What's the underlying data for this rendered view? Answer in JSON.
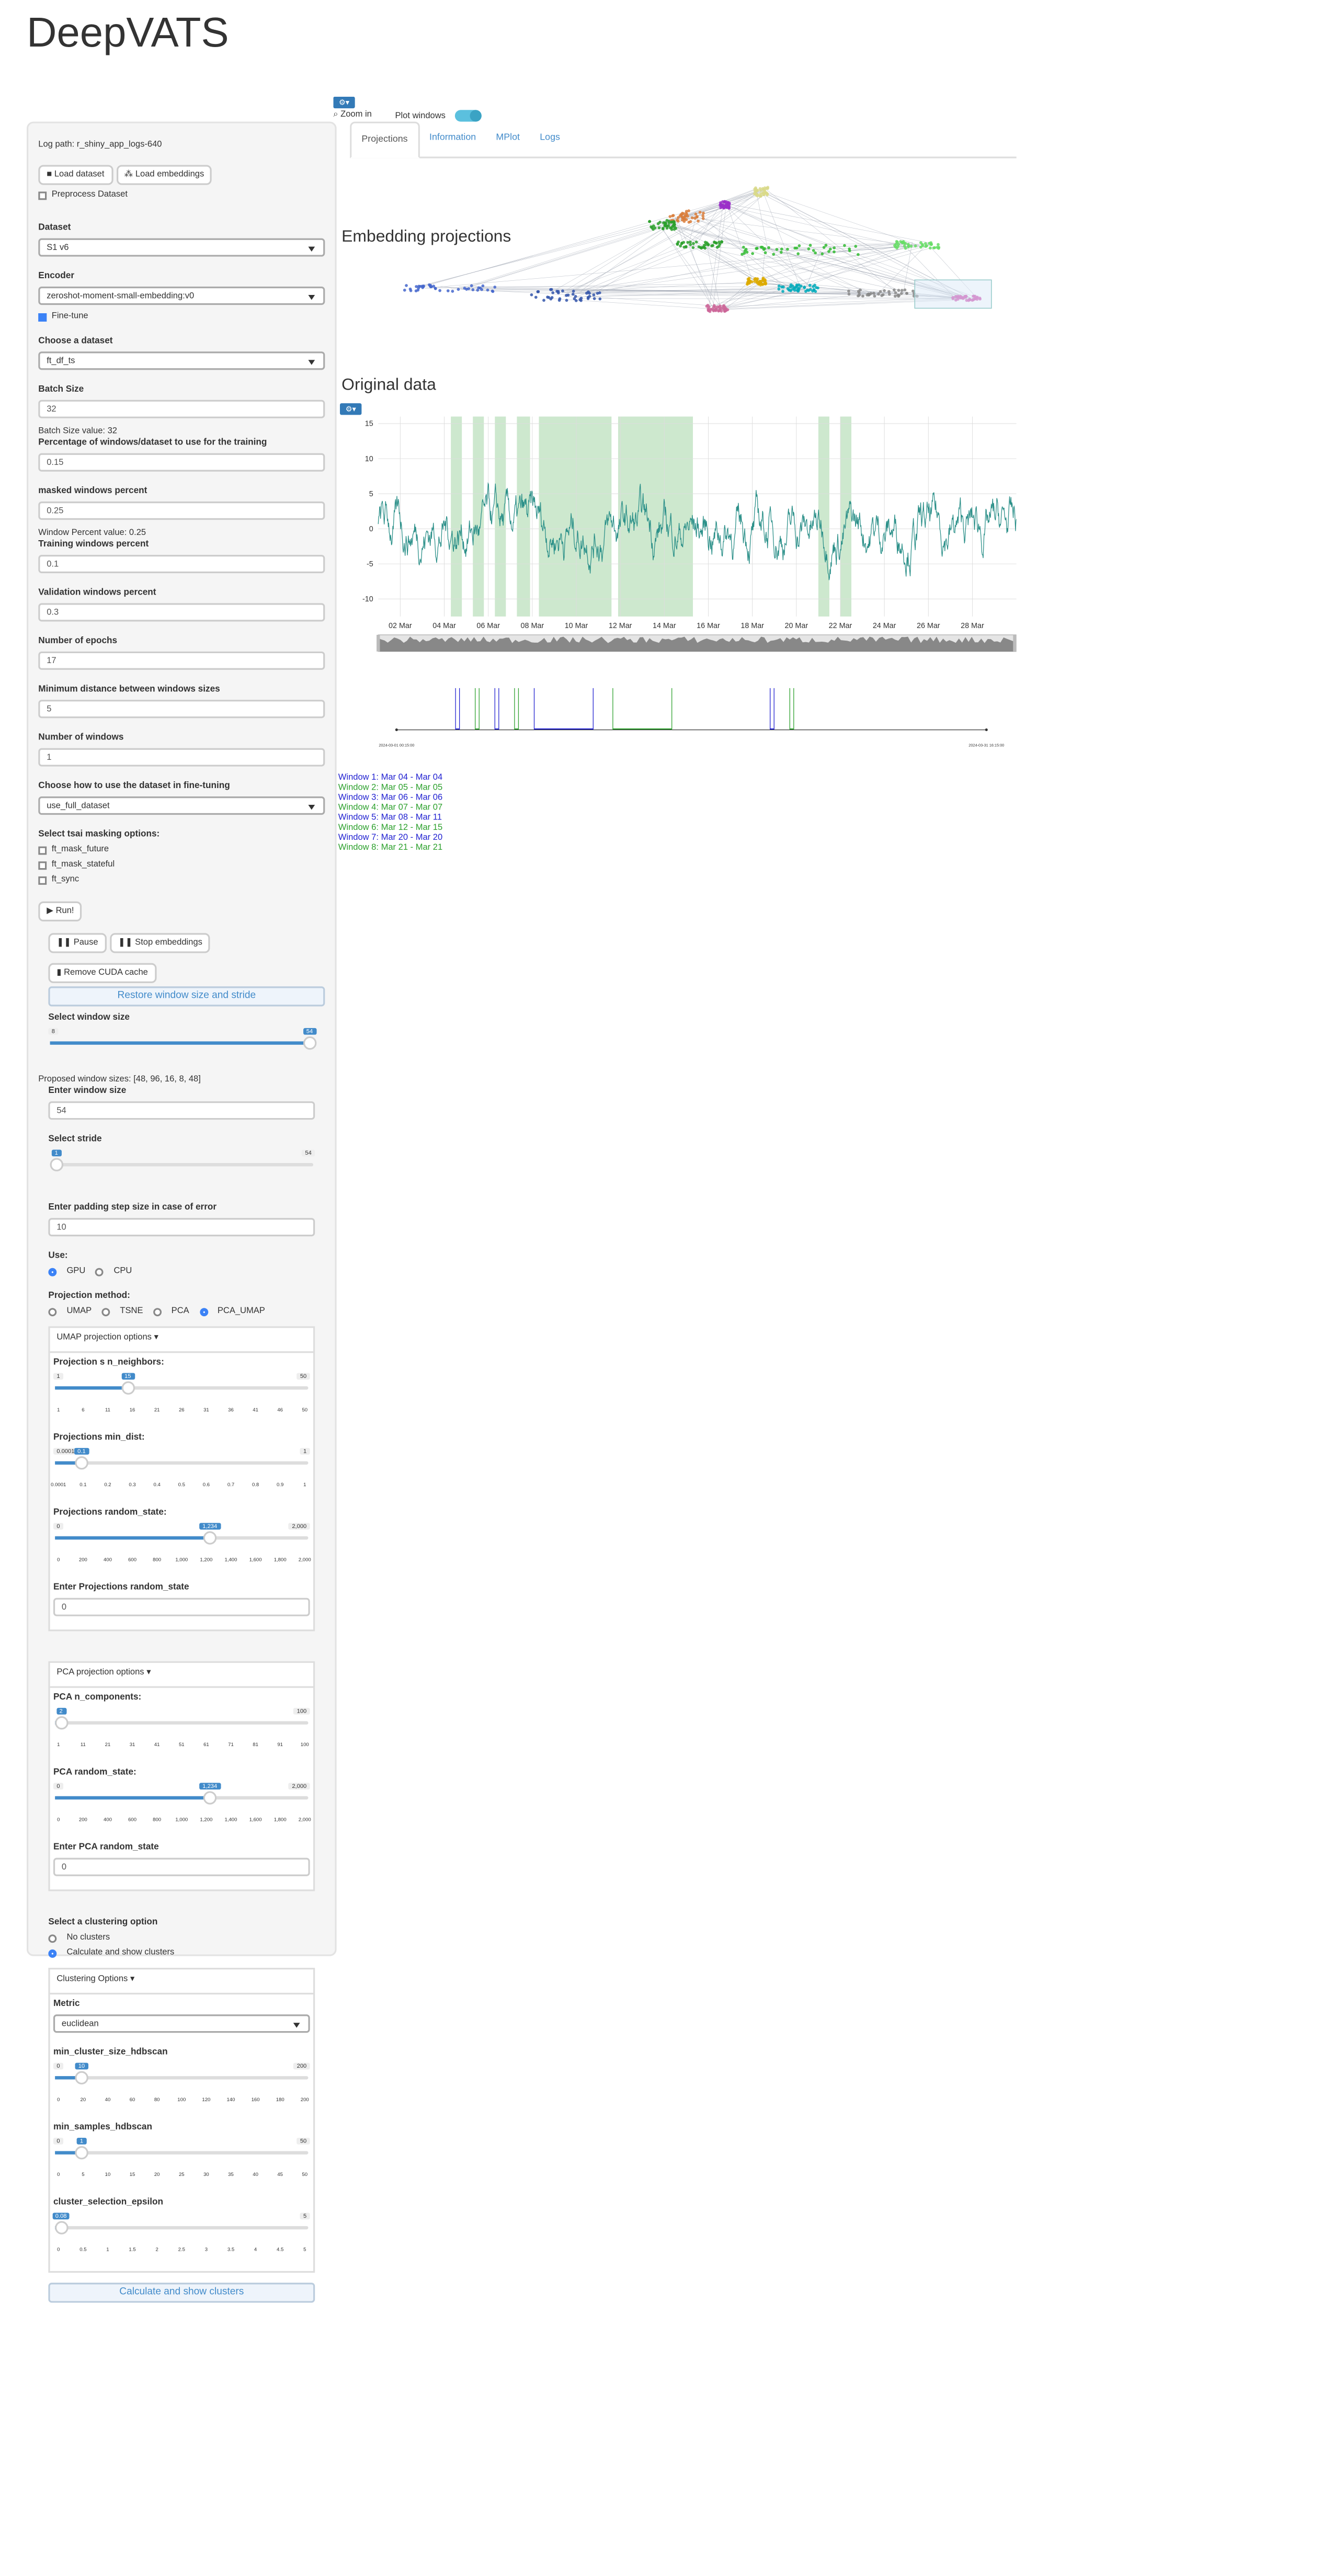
{
  "app": {
    "title": "DeepVATS"
  },
  "sidebar": {
    "log_path": "Log path: r_shiny_app_logs-640",
    "load_dataset": "Load dataset",
    "load_embeddings": "Load embeddings",
    "preprocess": "Preprocess Dataset",
    "dataset_label": "Dataset",
    "dataset_value": "S1 v6",
    "encoder_label": "Encoder",
    "encoder_value": "zeroshot-moment-small-embedding:v0",
    "finetune": "Fine-tune",
    "choose_dataset_label": "Choose a dataset",
    "choose_dataset_value": "ft_df_ts",
    "batch_label": "Batch Size",
    "batch_value": "32",
    "batch_note": "Batch Size value: 32",
    "pct_label": "Percentage of windows/dataset to use for the training",
    "pct_value": "0.15",
    "masked_label": "masked windows percent",
    "masked_value": "0.25",
    "window_pct_note": "Window Percent value: 0.25",
    "train_label": "Training windows percent",
    "train_value": "0.1",
    "val_label": "Validation windows percent",
    "val_value": "0.3",
    "epochs_label": "Number of epochs",
    "epochs_value": "17",
    "mindist_label": "Minimum distance between windows sizes",
    "mindist_value": "5",
    "nwin_label": "Number of windows",
    "nwin_value": "1",
    "howuse_label": "Choose how to use the dataset in fine-tuning",
    "howuse_value": "use_full_dataset",
    "mask_label": "Select tsai masking options:",
    "mask_opts": [
      "ft_mask_future",
      "ft_mask_stateful",
      "ft_sync"
    ],
    "run": "Run!",
    "pause": "Pause",
    "stop": "Stop embeddings",
    "remove": "Remove CUDA cache",
    "restore": "Restore window size and stride",
    "wsize_label": "Select window size",
    "wsize_min": "8",
    "wsize_max": "54",
    "proposed": "Proposed window sizes: [48, 96, 16, 8, 48]",
    "enter_wsize_label": "Enter window size",
    "enter_wsize_value": "54",
    "stride_label": "Select stride",
    "stride_min": "1",
    "stride_max": "54",
    "padding_label": "Enter padding step size in case of error",
    "padding_value": "10",
    "use_label": "Use:",
    "use_opts": [
      "GPU",
      "CPU"
    ],
    "proj_label": "Projection method:",
    "proj_opts": [
      "UMAP",
      "TSNE",
      "PCA",
      "PCA_UMAP"
    ],
    "umap_hd": "UMAP projection options",
    "nn_label": "Projection s n_neighbors:",
    "nn_min": "1",
    "nn_max": "50",
    "nn_val": "15",
    "nn_ticks": [
      "1",
      "6",
      "11",
      "16",
      "21",
      "26",
      "31",
      "36",
      "41",
      "46",
      "50"
    ],
    "md_label": "Projections min_dist:",
    "md_min": "0.0001",
    "md_max": "1",
    "md_val": "0.1",
    "md_ticks": [
      "0.0001",
      "0.1",
      "0.2",
      "0.3",
      "0.4",
      "0.5",
      "0.6",
      "0.7",
      "0.8",
      "0.9",
      "1"
    ],
    "rs_label": "Projections random_state:",
    "rs_min": "0",
    "rs_max": "2,000",
    "rs_val": "1,234",
    "rs_ticks": [
      "0",
      "200",
      "400",
      "600",
      "800",
      "1,000",
      "1,200",
      "1,400",
      "1,600",
      "1,800",
      "2,000"
    ],
    "ers_label": "Enter Projections random_state",
    "ers_value": "0",
    "pca_hd": "PCA projection options",
    "pcan_label": "PCA n_components:",
    "pcan_min": "1",
    "pcan_max": "100",
    "pcan_val": "2",
    "pcan_ticks": [
      "1",
      "11",
      "21",
      "31",
      "41",
      "51",
      "61",
      "71",
      "81",
      "91",
      "100"
    ],
    "pcars_label": "PCA random_state:",
    "pcars_min": "0",
    "pcars_max": "2,000",
    "pcars_val": "1,234",
    "epca_label": "Enter PCA random_state",
    "epca_value": "0",
    "cl_label": "Select a clustering option",
    "cl_opts": [
      "No clusters",
      "Calculate and show clusters"
    ],
    "cluster_hd": "Clustering Options",
    "metric_label": "Metric",
    "metric_value": "euclidean",
    "mcs_label": "min_cluster_size_hdbscan",
    "mcs_min": "0",
    "mcs_max": "200",
    "mcs_val": "10",
    "mcs_ticks": [
      "0",
      "20",
      "40",
      "60",
      "80",
      "100",
      "120",
      "140",
      "160",
      "180",
      "200"
    ],
    "ms_label": "min_samples_hdbscan",
    "ms_min": "0",
    "ms_max": "50",
    "ms_val": "1",
    "ms_ticks": [
      "0",
      "5",
      "10",
      "15",
      "20",
      "25",
      "30",
      "35",
      "40",
      "45",
      "50"
    ],
    "eps_label": "cluster_selection_epsilon",
    "eps_min": "0",
    "eps_max": "5",
    "eps_val": "0.08",
    "eps_ticks": [
      "0",
      "0.5",
      "1",
      "1.5",
      "2",
      "2.5",
      "3",
      "3.5",
      "4",
      "4.5",
      "5"
    ],
    "calc_btn": "Calculate and show clusters"
  },
  "tabs": [
    "Projections",
    "Information",
    "MPlot",
    "Logs"
  ],
  "main": {
    "emb_title": "Embedding projections",
    "zoom": "Zoom in",
    "plot_windows": "Plot windows",
    "orig_title": "Original data",
    "yticks": [
      "15",
      "10",
      "5",
      "0",
      "-5",
      "-10"
    ],
    "xticks": [
      "02 Mar",
      "04 Mar",
      "06 Mar",
      "08 Mar",
      "10 Mar",
      "12 Mar",
      "14 Mar",
      "16 Mar",
      "18 Mar",
      "20 Mar",
      "22 Mar",
      "24 Mar",
      "26 Mar",
      "28 Mar"
    ],
    "tl_start": "2024-03-01 00:15:00",
    "tl_end": "2024-03-31 16:15:00",
    "windows": [
      {
        "label": "Window 1: Mar 04 - Mar 04",
        "color": "#1f1fd0"
      },
      {
        "label": "Window 2: Mar 05 - Mar 05",
        "color": "#2ca02c"
      },
      {
        "label": "Window 3: Mar 06 - Mar 06",
        "color": "#1f1fd0"
      },
      {
        "label": "Window 4: Mar 07 - Mar 07",
        "color": "#2ca02c"
      },
      {
        "label": "Window 5: Mar 08 - Mar 11",
        "color": "#1f1fd0"
      },
      {
        "label": "Window 6: Mar 12 - Mar 15",
        "color": "#2ca02c"
      },
      {
        "label": "Window 7: Mar 20 - Mar 20",
        "color": "#1f1fd0"
      },
      {
        "label": "Window 8: Mar 21 - Mar 21",
        "color": "#2ca02c"
      }
    ],
    "series_color": "#2a8f88",
    "highlight_color": "#c8e6c9"
  }
}
